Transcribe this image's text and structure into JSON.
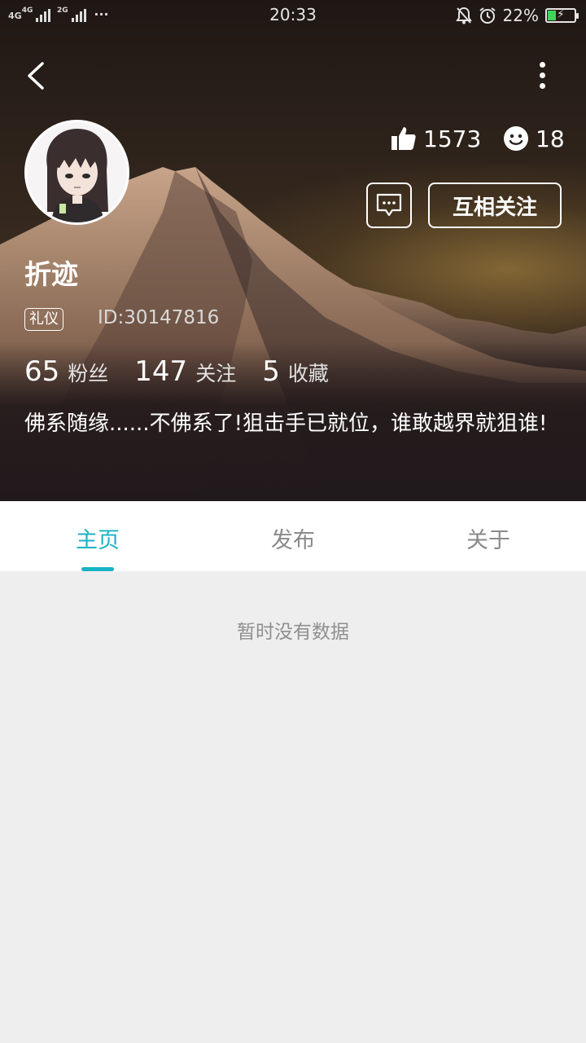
{
  "status_bar": {
    "network_left": "4G",
    "network_mid": "4G",
    "network_right": "2G",
    "dots": "···",
    "time": "20:33",
    "battery_percent": "22%"
  },
  "profile": {
    "username": "折迹",
    "tag": "礼仪",
    "id_text": "ID:30147816",
    "likes": "1573",
    "smiles": "18",
    "follow_button": "互相关注",
    "counts": [
      {
        "value": "65",
        "label": "粉丝"
      },
      {
        "value": "147",
        "label": "关注"
      },
      {
        "value": "5",
        "label": "收藏"
      }
    ],
    "bio": "佛系随缘......不佛系了!狙击手已就位，谁敢越界就狙谁!"
  },
  "tabs": [
    {
      "label": "主页",
      "active": true
    },
    {
      "label": "发布",
      "active": false
    },
    {
      "label": "关于",
      "active": false
    }
  ],
  "empty_text": "暂时没有数据",
  "colors": {
    "accent": "#18b3c4",
    "page_background": "#eeeeee"
  },
  "icons": {
    "back": "chevron-left-icon",
    "more": "more-vertical-icon",
    "like": "thumbs-up-icon",
    "smile": "smile-icon",
    "message": "message-icon"
  }
}
